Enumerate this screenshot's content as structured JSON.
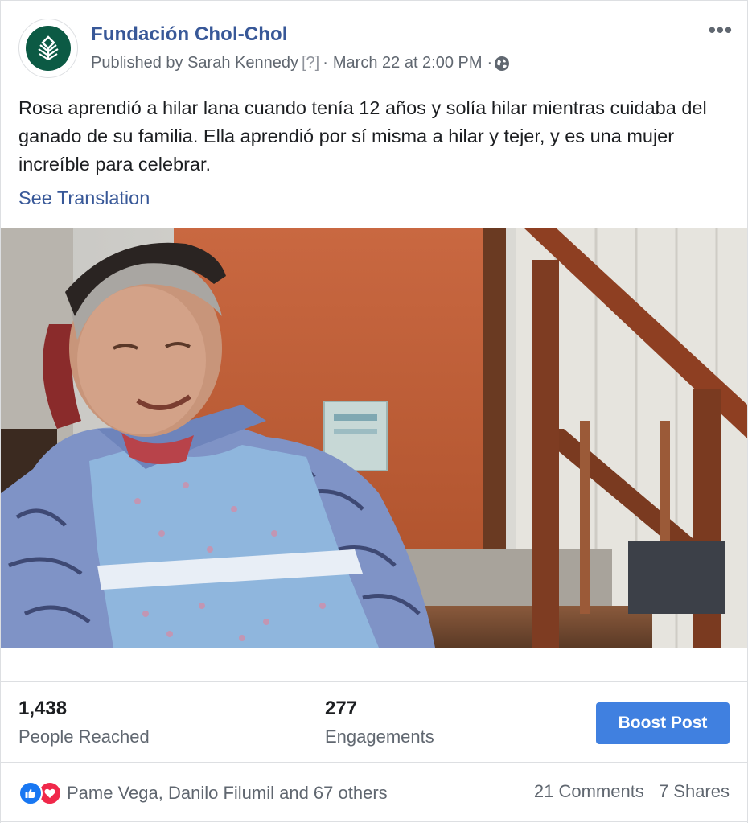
{
  "post": {
    "page_name": "Fundación Chol-Chol",
    "published_by": "Published by Sarah Kennedy",
    "help_marker": "[?]",
    "separator": "·",
    "timestamp": "March 22 at 2:00 PM",
    "more_label": "•••",
    "text": "Rosa aprendió a hilar lana cuando tenía 12 años y solía hilar mientras cuidaba del ganado de su familia. Ella aprendió por sí misma a hilar y tejer, y es una mujer increíble para celebrar.",
    "see_translation": "See Translation",
    "icons": {
      "avatar": "leaf-logo-icon",
      "privacy": "globe-icon",
      "more": "more-icon"
    },
    "colors": {
      "link": "#385898",
      "logo": "#0c5a44",
      "boost": "#4080e0"
    }
  },
  "insights": {
    "reached_value": "1,438",
    "reached_label": "People Reached",
    "engagements_value": "277",
    "engagements_label": "Engagements",
    "boost_label": "Boost Post"
  },
  "footer": {
    "reaction_names": "Pame Vega, Danilo Filumil and 67 others",
    "comments": "21 Comments",
    "shares": "7 Shares",
    "reaction_icons": [
      "like-icon",
      "love-icon"
    ],
    "colors": {
      "like": "#1877f2",
      "love": "#f0284a"
    }
  }
}
